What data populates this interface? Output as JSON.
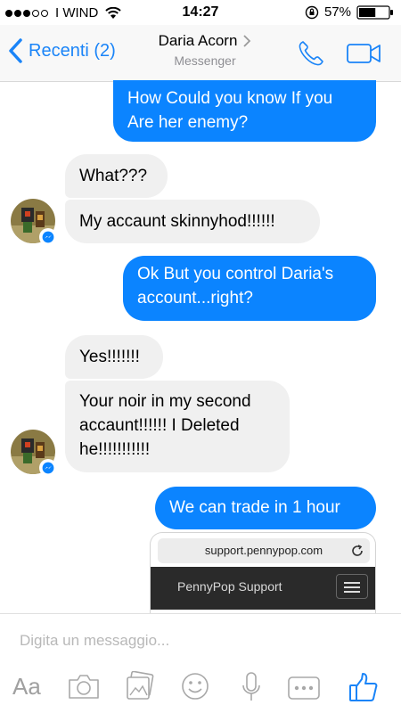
{
  "status_bar": {
    "carrier": "I WIND",
    "time": "14:27",
    "battery": "57%",
    "battery_level": 0.57
  },
  "nav": {
    "back_label": "Recenti (2)",
    "title": "Daria Acorn",
    "subtitle": "Messenger"
  },
  "messages": [
    {
      "from": "me",
      "text": "How Could you know If you Are her enemy?"
    },
    {
      "from": "them",
      "text": "What???"
    },
    {
      "from": "them",
      "text": "My accaunt skinnyhod!!!!!!"
    },
    {
      "from": "me",
      "text": "Ok But you control Daria's account...right?"
    },
    {
      "from": "them",
      "text": "Yes!!!!!!!"
    },
    {
      "from": "them",
      "text": "Your noir in my second accaunt!!!!!! I Deleted he!!!!!!!!!!!"
    },
    {
      "from": "me",
      "text": "We can trade in 1 hour"
    }
  ],
  "link_preview": {
    "url": "support.pennypop.com",
    "site_name": "PennyPop Support"
  },
  "composer": {
    "placeholder": "Digita un messaggio...",
    "aa_label": "Aa"
  },
  "colors": {
    "accent": "#0b84ff",
    "incoming_bubble": "#f0f0f0"
  }
}
